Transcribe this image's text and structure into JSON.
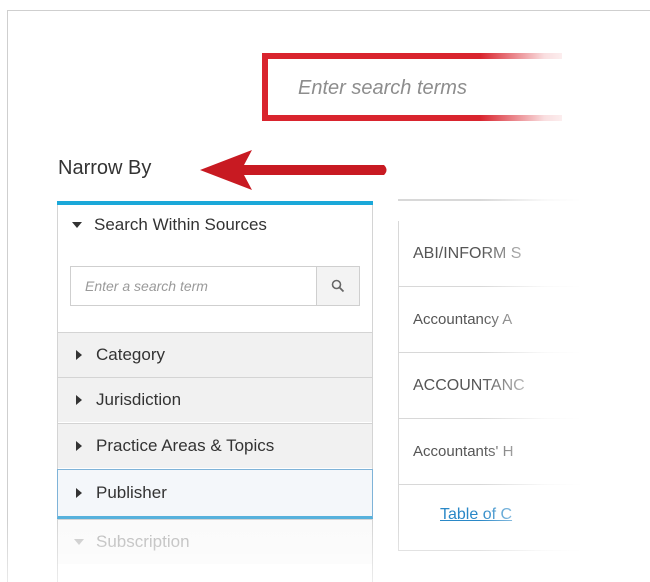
{
  "search": {
    "placeholder": "Enter search terms"
  },
  "narrow_by": {
    "title": "Narrow By"
  },
  "facets": {
    "search_within": {
      "label": "Search Within Sources",
      "input_placeholder": "Enter a search term"
    },
    "items": [
      {
        "label": "Category"
      },
      {
        "label": "Jurisdiction"
      },
      {
        "label": "Practice Areas & Topics"
      },
      {
        "label": "Publisher"
      },
      {
        "label": "Subscription"
      }
    ]
  },
  "results": {
    "rows": [
      {
        "text": "ABI/INFORM S"
      },
      {
        "text": "Accountancy A"
      },
      {
        "text": "ACCOUNTANC"
      },
      {
        "text": "Accountants' H"
      }
    ],
    "toc_link": "Table of C"
  },
  "colors": {
    "highlight_red": "#d9242e",
    "accent_blue": "#1ba8d9",
    "link_blue": "#2a88c7"
  }
}
